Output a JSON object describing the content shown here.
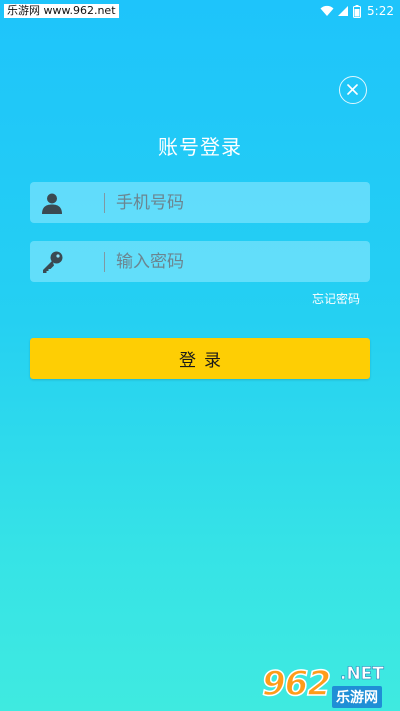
{
  "status_bar": {
    "watermark": "乐游网 www.962.net",
    "time": "5:22",
    "icons": [
      "wifi-icon",
      "signal-icon",
      "battery-icon"
    ]
  },
  "close": {
    "icon": "close-icon"
  },
  "page": {
    "title": "账号登录"
  },
  "phone_field": {
    "placeholder": "手机号码",
    "icon": "user-icon"
  },
  "password_field": {
    "placeholder": "输入密码",
    "icon": "key-icon"
  },
  "forgot_password": "忘记密码",
  "login_button": "登录",
  "watermark_logo": {
    "digits": "962",
    "suffix": ".NET",
    "cn": "乐游网"
  },
  "colors": {
    "background_top": "#1ec4fb",
    "background_bottom": "#3feae0",
    "button": "#fece04",
    "text": "#ffffff"
  }
}
